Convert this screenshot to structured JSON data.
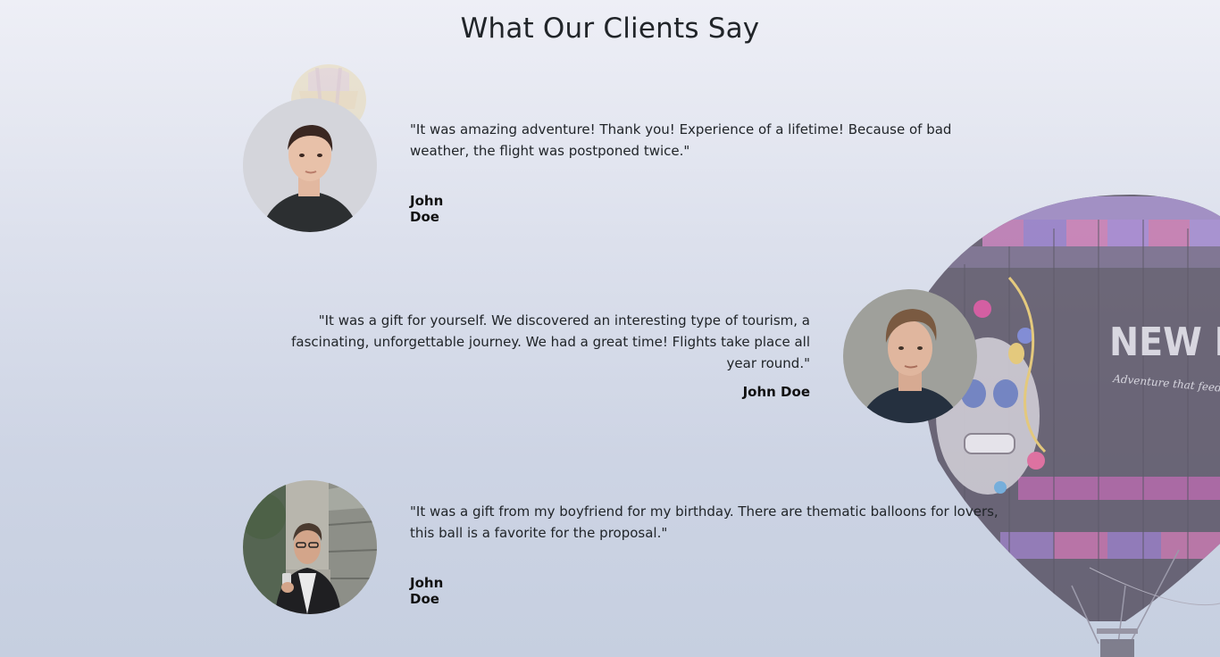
{
  "section": {
    "title": "What Our Clients Say"
  },
  "testimonials": [
    {
      "quote": "\"It was amazing adventure! Thank you! Experience of a lifetime! Because of bad weather, the flight was postponed twice.\"",
      "author": "John Doe",
      "avatar_icon": "client-photo-dark-hair-man"
    },
    {
      "quote": "\"It was a gift for yourself. We discovered an interesting type of tourism, a fascinating, unforgettable journey. We had a great time! Flights take place all year round.\"",
      "author": "John Doe",
      "avatar_icon": "client-photo-light-hair-man"
    },
    {
      "quote": "\"It was a gift from my boyfriend for my birthday. There are thematic balloons for lovers, this ball is a favorite for the proposal.\"",
      "author": "John Doe",
      "avatar_icon": "client-photo-man-with-phone"
    }
  ],
  "background": {
    "balloon_text": "NEW MEX",
    "balloon_subtext": "Adventure that feeds t",
    "colors": {
      "background_top": "#eeeff6",
      "background_bottom": "#c6cfe0",
      "text": "#212529"
    }
  }
}
